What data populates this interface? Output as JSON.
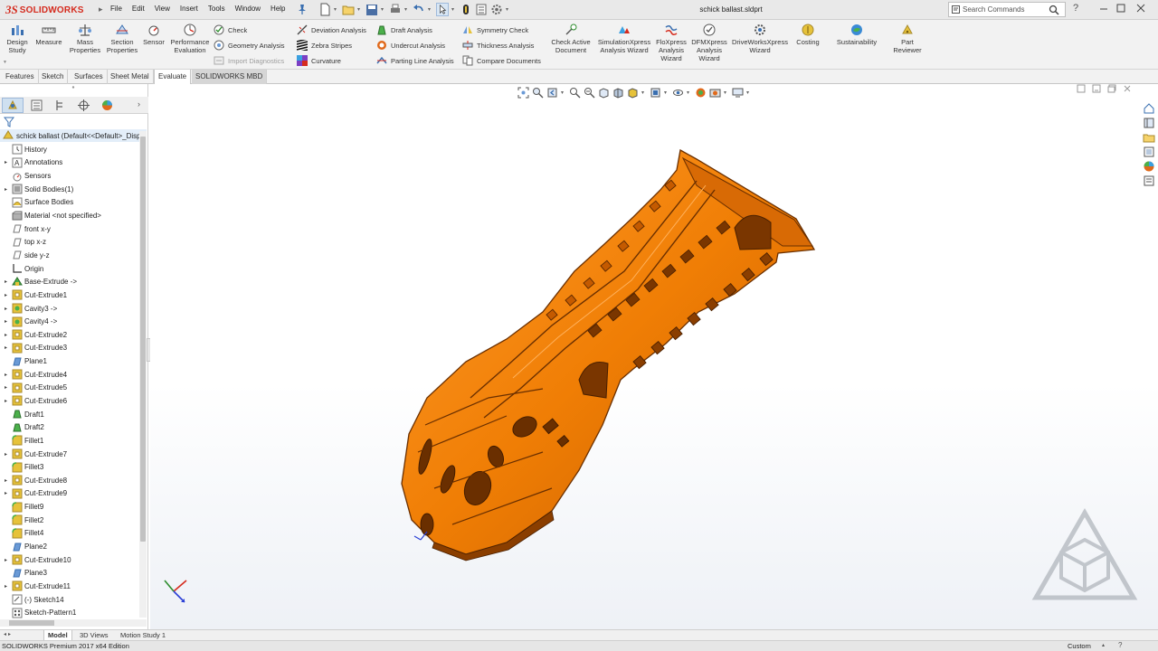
{
  "app": {
    "logo_ds": "3S",
    "logo_name": "SOLIDWORKS",
    "document_title": "schick ballast.sldprt"
  },
  "menu": [
    "File",
    "Edit",
    "View",
    "Insert",
    "Tools",
    "Window",
    "Help"
  ],
  "search": {
    "placeholder": "Search Commands"
  },
  "ribbon": {
    "design_study": "Design Study",
    "measure": "Measure",
    "mass_properties": "Mass Properties",
    "section_properties": "Section Properties",
    "sensor": "Sensor",
    "performance_evaluation": "Performance Evaluation",
    "check": "Check",
    "geometry_analysis": "Geometry Analysis",
    "import_diagnostics": "Import Diagnostics",
    "deviation_analysis": "Deviation Analysis",
    "zebra_stripes": "Zebra Stripes",
    "curvature": "Curvature",
    "draft_analysis": "Draft Analysis",
    "undercut_analysis": "Undercut Analysis",
    "parting_line_analysis": "Parting Line Analysis",
    "symmetry_check": "Symmetry Check",
    "thickness_analysis": "Thickness Analysis",
    "compare_documents": "Compare Documents",
    "check_active_document": "Check Active Document",
    "simulationxpress": "SimulationXpress Analysis Wizard",
    "floxpress": "FloXpress Analysis Wizard",
    "dfmxpress": "DFMXpress Analysis Wizard",
    "driveworksxpress": "DriveWorksXpress Wizard",
    "costing": "Costing",
    "sustainability": "Sustainability",
    "part_reviewer": "Part Reviewer"
  },
  "tabs": [
    "Features",
    "Sketch",
    "Surfaces",
    "Sheet Metal",
    "Evaluate",
    "SOLIDWORKS MBD"
  ],
  "active_tab": "Evaluate",
  "tree": {
    "root": "schick ballast  (Default<<Default>_Disp",
    "items": [
      {
        "label": "History",
        "exp": false,
        "icon": "history-icon"
      },
      {
        "label": "Annotations",
        "exp": true,
        "icon": "annotations-icon"
      },
      {
        "label": "Sensors",
        "exp": false,
        "icon": "sensors-icon"
      },
      {
        "label": "Solid Bodies(1)",
        "exp": true,
        "icon": "solid-bodies-icon"
      },
      {
        "label": "Surface Bodies",
        "exp": false,
        "icon": "surface-bodies-icon"
      },
      {
        "label": "Material <not specified>",
        "exp": false,
        "icon": "material-icon"
      },
      {
        "label": "front x-y",
        "exp": false,
        "icon": "plane-icon"
      },
      {
        "label": "top x-z",
        "exp": false,
        "icon": "plane-icon"
      },
      {
        "label": "side y-z",
        "exp": false,
        "icon": "plane-icon"
      },
      {
        "label": "Origin",
        "exp": false,
        "icon": "origin-icon"
      },
      {
        "label": "Base-Extrude ->",
        "exp": true,
        "icon": "extrude-icon"
      },
      {
        "label": "Cut-Extrude1",
        "exp": true,
        "icon": "cut-extrude-icon"
      },
      {
        "label": "Cavity3 ->",
        "exp": true,
        "icon": "cavity-icon"
      },
      {
        "label": "Cavity4 ->",
        "exp": true,
        "icon": "cavity-icon"
      },
      {
        "label": "Cut-Extrude2",
        "exp": true,
        "icon": "cut-extrude-icon"
      },
      {
        "label": "Cut-Extrude3",
        "exp": true,
        "icon": "cut-extrude-icon"
      },
      {
        "label": "Plane1",
        "exp": false,
        "icon": "ref-plane-icon"
      },
      {
        "label": "Cut-Extrude4",
        "exp": true,
        "icon": "cut-extrude-icon"
      },
      {
        "label": "Cut-Extrude5",
        "exp": true,
        "icon": "cut-extrude-icon"
      },
      {
        "label": "Cut-Extrude6",
        "exp": true,
        "icon": "cut-extrude-icon"
      },
      {
        "label": "Draft1",
        "exp": false,
        "icon": "draft-icon"
      },
      {
        "label": "Draft2",
        "exp": false,
        "icon": "draft-icon"
      },
      {
        "label": "Fillet1",
        "exp": false,
        "icon": "fillet-icon"
      },
      {
        "label": "Cut-Extrude7",
        "exp": true,
        "icon": "cut-extrude-icon"
      },
      {
        "label": "Fillet3",
        "exp": false,
        "icon": "fillet-icon"
      },
      {
        "label": "Cut-Extrude8",
        "exp": true,
        "icon": "cut-extrude-icon"
      },
      {
        "label": "Cut-Extrude9",
        "exp": true,
        "icon": "cut-extrude-icon"
      },
      {
        "label": "Fillet9",
        "exp": false,
        "icon": "fillet-icon"
      },
      {
        "label": "Fillet2",
        "exp": false,
        "icon": "fillet-icon"
      },
      {
        "label": "Fillet4",
        "exp": false,
        "icon": "fillet-icon"
      },
      {
        "label": "Plane2",
        "exp": false,
        "icon": "ref-plane-icon"
      },
      {
        "label": "Cut-Extrude10",
        "exp": true,
        "icon": "cut-extrude-icon"
      },
      {
        "label": "Plane3",
        "exp": false,
        "icon": "ref-plane-icon"
      },
      {
        "label": "Cut-Extrude11",
        "exp": true,
        "icon": "cut-extrude-icon"
      },
      {
        "label": "(-) Sketch14",
        "exp": false,
        "icon": "sketch-icon"
      },
      {
        "label": "Sketch-Pattern1",
        "exp": false,
        "icon": "sketch-pattern-icon"
      }
    ]
  },
  "bottom_tabs": [
    "Model",
    "3D Views",
    "Motion Study 1"
  ],
  "status": {
    "text": "SOLIDWORKS Premium 2017 x64 Edition",
    "units": "Custom"
  },
  "colors": {
    "part_orange": "#f07e05",
    "part_dark": "#8a3e00",
    "brand_red": "#d52b1e",
    "accent_blue": "#3a6fb0"
  }
}
